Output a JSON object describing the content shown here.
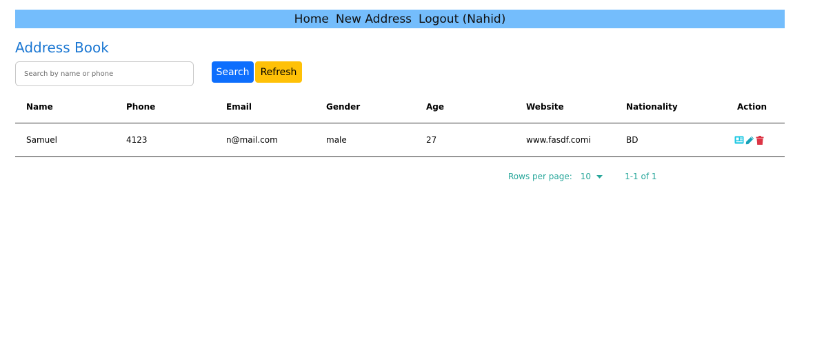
{
  "nav": {
    "home": "Home",
    "new_address": "New Address",
    "logout": "Logout (Nahid)"
  },
  "page_title": "Address Book",
  "search": {
    "placeholder": "Search by name or phone",
    "value": "",
    "search_label": "Search",
    "refresh_label": "Refresh"
  },
  "table": {
    "columns": [
      "Name",
      "Phone",
      "Email",
      "Gender",
      "Age",
      "Website",
      "Nationality",
      "Action"
    ],
    "rows": [
      {
        "name": "Samuel",
        "phone": "4123",
        "email": "n@mail.com",
        "gender": "male",
        "age": "27",
        "website": "www.fasdf.comi",
        "nationality": "BD",
        "actions": [
          "view-icon",
          "edit-icon",
          "delete-icon"
        ]
      }
    ]
  },
  "pagination": {
    "rows_per_page_label": "Rows per page:",
    "rows_per_page_value": "10",
    "range": "1-1 of 1"
  },
  "colors": {
    "nav_bg": "#74bdfc",
    "title": "#1976d2",
    "search_button": "#0d6efd",
    "refresh_button": "#ffc107",
    "view_icon": "#1fc8e3",
    "edit_icon": "#17a2b8",
    "delete_icon": "#dc3545",
    "pagination_text": "#26a69a"
  }
}
